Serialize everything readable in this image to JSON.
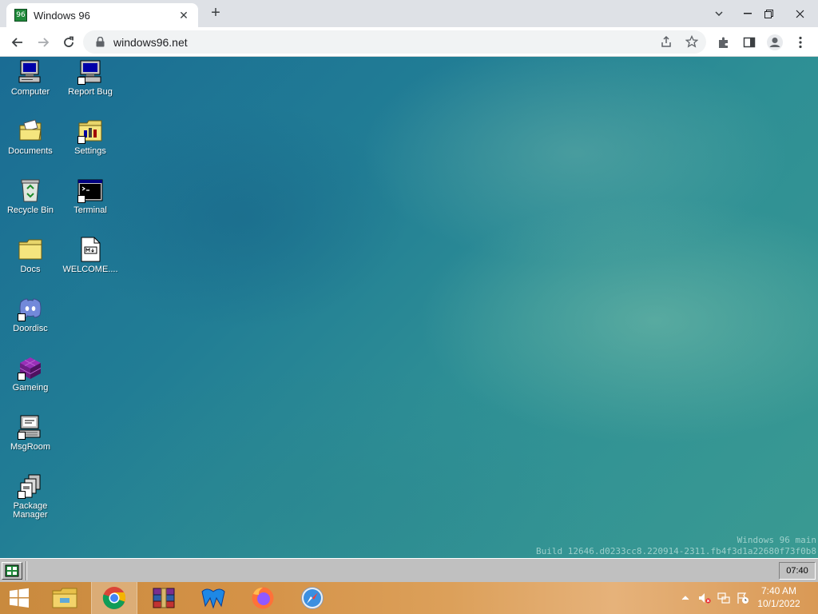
{
  "browser": {
    "tab_title": "Windows 96",
    "tab_close_glyph": "✕",
    "new_tab_glyph": "+",
    "url": "windows96.net"
  },
  "desktop": {
    "icons": [
      {
        "label": "Computer",
        "icon": "computer-icon"
      },
      {
        "label": "Report Bug",
        "icon": "report-bug-icon"
      },
      {
        "label": "Documents",
        "icon": "documents-folder-icon"
      },
      {
        "label": "Settings",
        "icon": "settings-folder-icon"
      },
      {
        "label": "Recycle Bin",
        "icon": "recycle-bin-icon"
      },
      {
        "label": "Terminal",
        "icon": "terminal-icon"
      },
      {
        "label": "Docs",
        "icon": "folder-icon"
      },
      {
        "label": "WELCOME....",
        "icon": "markdown-file-icon"
      },
      {
        "label": "Doordisc",
        "icon": "discord-icon"
      },
      {
        "label": "Gameing",
        "icon": "game-cube-icon"
      },
      {
        "label": "MsgRoom",
        "icon": "msgroom-icon"
      },
      {
        "label": "Package\nManager",
        "icon": "package-manager-icon"
      }
    ],
    "build_line1": "Windows 96 main",
    "build_line2": "Build 12646.d0233cc8.220914-2311.fb4f3d1a22680f73f0b8"
  },
  "win96_taskbar": {
    "clock": "07:40"
  },
  "host_taskbar": {
    "apps": [
      "file-explorer",
      "chrome",
      "winrar",
      "malwarebytes",
      "firefox",
      "safari"
    ],
    "active_app": "chrome",
    "time": "7:40 AM",
    "date": "10/1/2022",
    "colors": {
      "accent": "#d49247"
    }
  }
}
